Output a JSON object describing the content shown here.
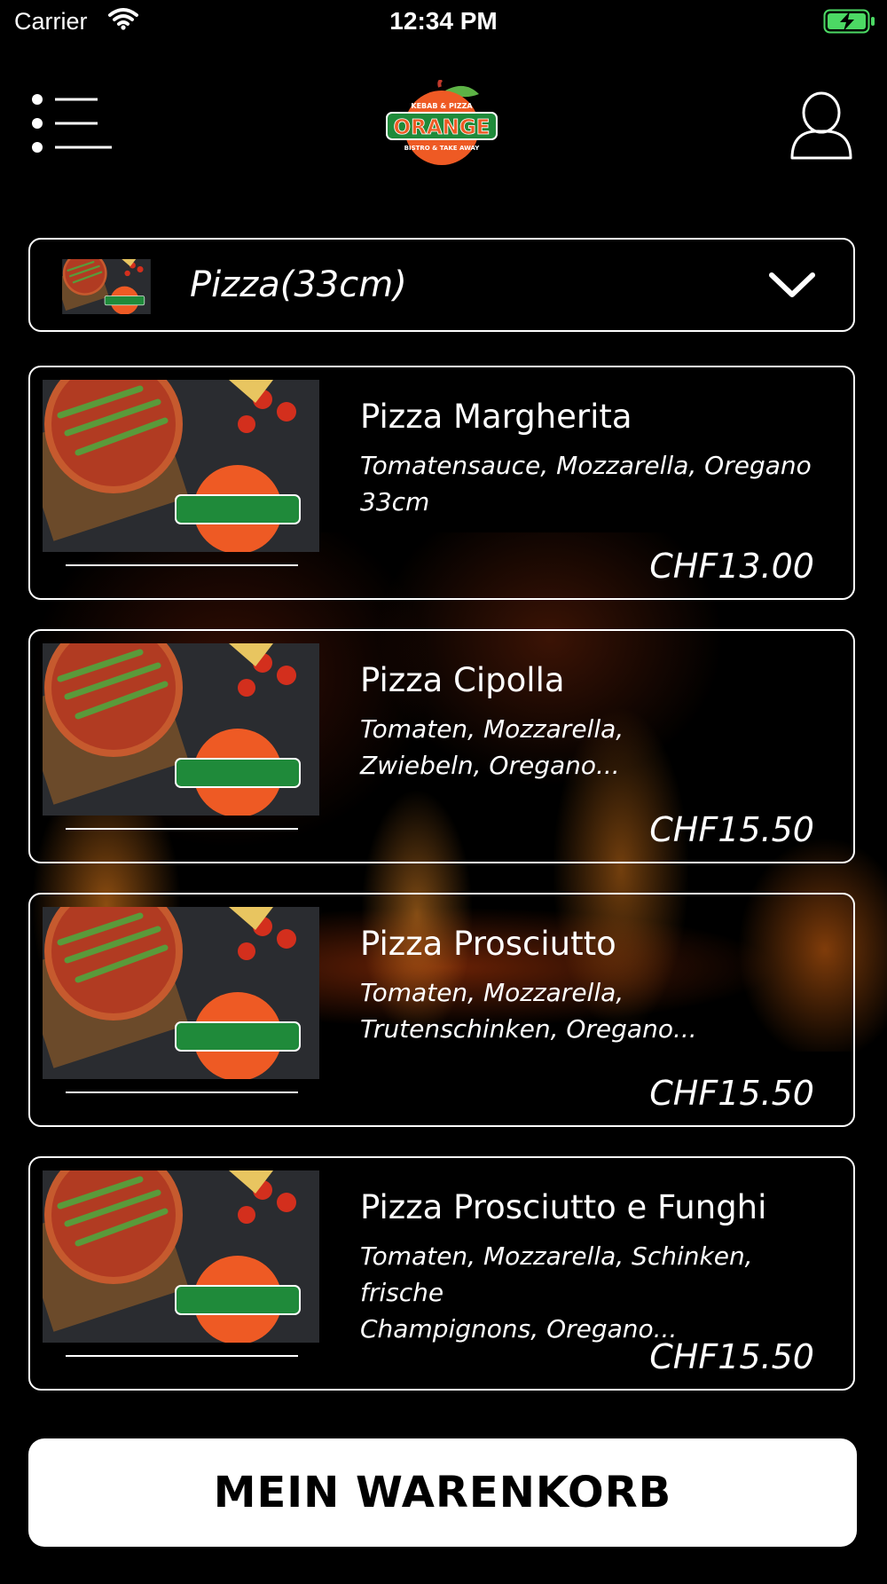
{
  "status_bar": {
    "carrier": "Carrier",
    "time": "12:34 PM"
  },
  "header": {
    "menu_icon": "list-menu-icon",
    "profile_icon": "user-profile-icon",
    "logo": {
      "top_text": "KEBAB & PIZZA",
      "main_text": "ORANGE",
      "bottom_text": "BISTRO & TAKE AWAY"
    }
  },
  "category": {
    "selected": "Pizza(33cm)",
    "dropdown_icon": "chevron-down-icon"
  },
  "products": [
    {
      "name": "Pizza Margherita",
      "description_line1": "Tomatensauce, Mozzarella, Oregano",
      "description_line2": "33cm",
      "price": "CHF13.00"
    },
    {
      "name": "Pizza Cipolla",
      "description_line1": "Tomaten, Mozzarella,",
      "description_line2": "Zwiebeln, Oregano...",
      "price": "CHF15.50"
    },
    {
      "name": "Pizza Prosciutto",
      "description_line1": "Tomaten, Mozzarella,",
      "description_line2": "Trutenschinken, Oregano...",
      "price": "CHF15.50"
    },
    {
      "name": "Pizza Prosciutto e Funghi",
      "description_line1": "Tomaten, Mozzarella, Schinken, frische",
      "description_line2": "Champignons, Oregano...",
      "price": "CHF15.50"
    }
  ],
  "cart_button": {
    "label": "MEIN WARENKORB"
  },
  "colors": {
    "background": "#000000",
    "foreground": "#ffffff",
    "logo_orange": "#ee5a24",
    "logo_green": "#1f8a3a",
    "battery_green": "#4cd964"
  }
}
